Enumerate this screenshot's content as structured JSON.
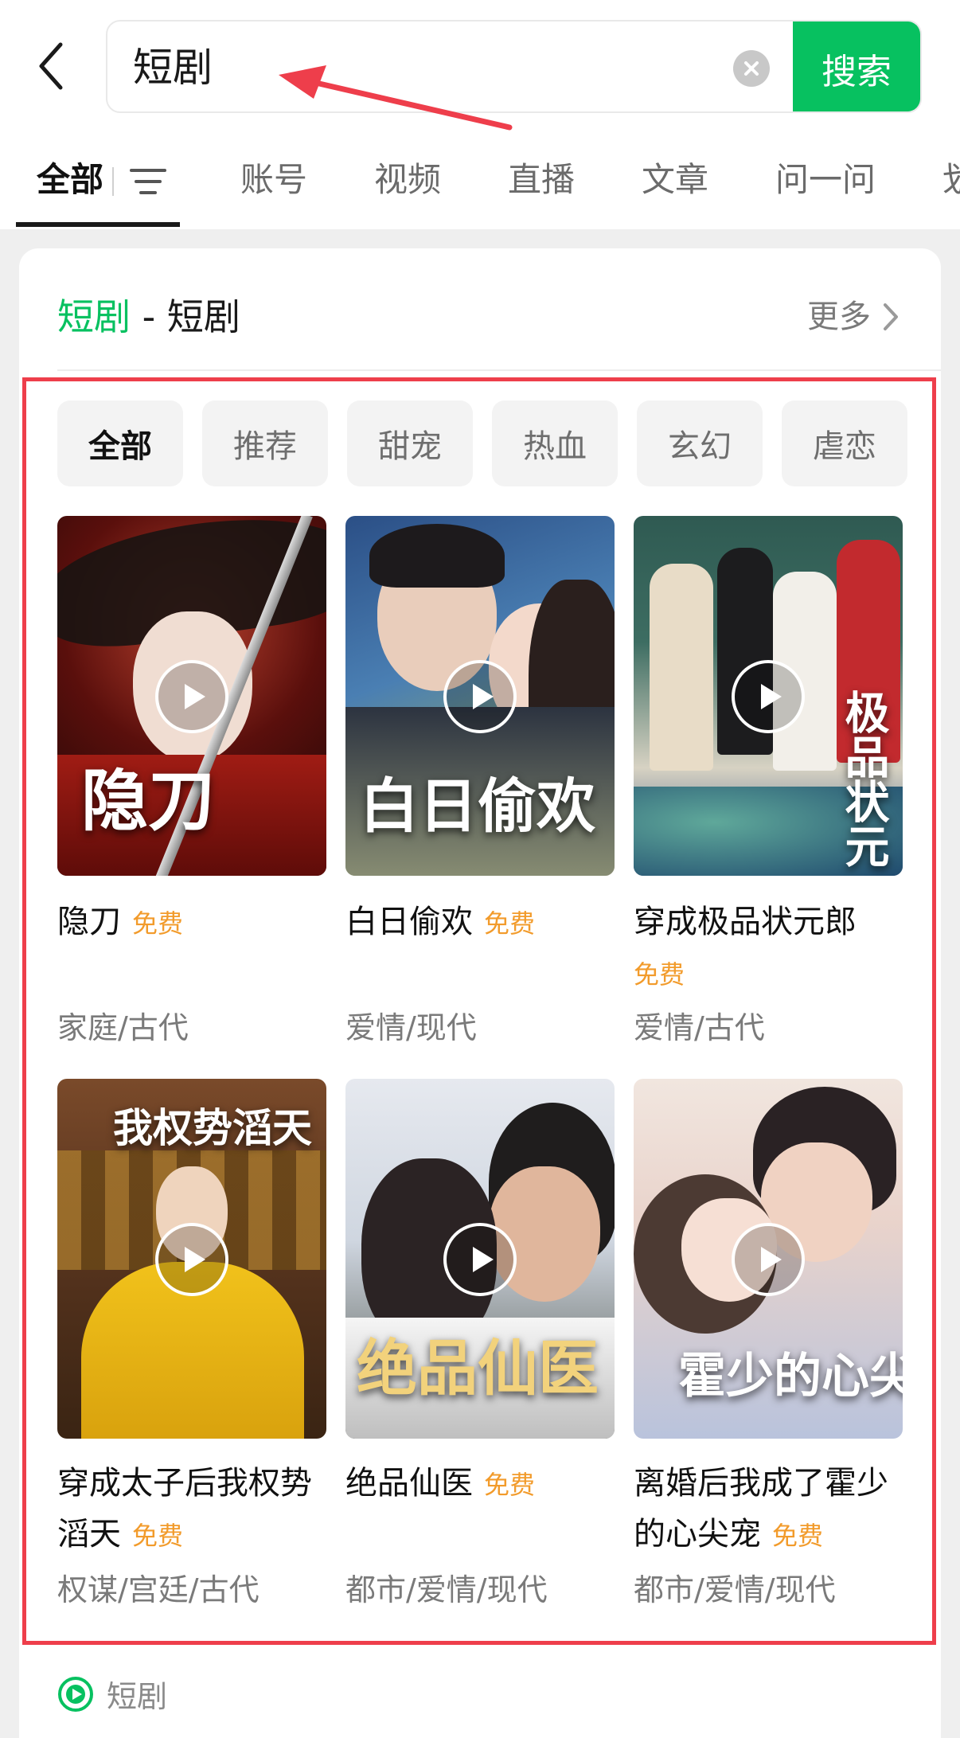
{
  "search": {
    "query": "短剧",
    "button_label": "搜索"
  },
  "tabs": [
    "全部",
    "账号",
    "视频",
    "直播",
    "文章",
    "问一问",
    "划"
  ],
  "section": {
    "title_highlight": "短剧",
    "title_sep": " - ",
    "title_rest": "短剧",
    "more_label": "更多"
  },
  "chips": [
    "全部",
    "推荐",
    "甜宠",
    "热血",
    "玄幻",
    "虐恋"
  ],
  "dramas": [
    {
      "name": "隐刀",
      "badge": "免费",
      "genre": "家庭/古代",
      "poster_title": "隐刀"
    },
    {
      "name": "白日偷欢",
      "badge": "免费",
      "genre": "爱情/现代",
      "poster_title": "白日偷欢"
    },
    {
      "name": "穿成极品状元郎",
      "badge": "免费",
      "genre": "爱情/古代",
      "poster_title": "极品状元"
    },
    {
      "name": "穿成太子后我权势滔天",
      "badge": "免费",
      "genre": "权谋/宫廷/古代",
      "poster_title": "我权势滔天"
    },
    {
      "name": "绝品仙医",
      "badge": "免费",
      "genre": "都市/爱情/现代",
      "poster_title": "绝品仙医"
    },
    {
      "name": "离婚后我成了霍少的心尖宠",
      "badge": "免费",
      "genre": "都市/爱情/现代",
      "poster_title": "霍少的心尖宠"
    }
  ],
  "source_label": "短剧",
  "colors": {
    "brand_green": "#07c160",
    "badge_orange": "#f29b2b",
    "annotation_red": "#ee3e4b"
  },
  "icons": [
    "back-arrow-icon",
    "clear-icon",
    "filter-icon",
    "chevron-right-icon",
    "play-icon",
    "mini-program-icon"
  ]
}
